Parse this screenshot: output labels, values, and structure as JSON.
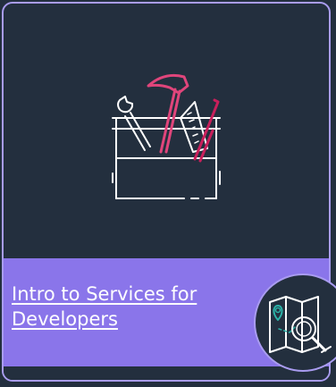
{
  "card": {
    "title": "Intro to Services for Developers",
    "title_line1": "Intro to Services for",
    "title_line2": "Developers",
    "illustration_icon": "toolbox-icon",
    "badge_icon": "map-search-icon"
  },
  "colors": {
    "background": "#232f3e",
    "border": "#a99cf0",
    "title_band": "#8a75ea",
    "hammer": "#e0457b",
    "screwdriver": "#c91f5b",
    "outline": "#ffffff",
    "badge_accent": "#2bb3a8"
  }
}
